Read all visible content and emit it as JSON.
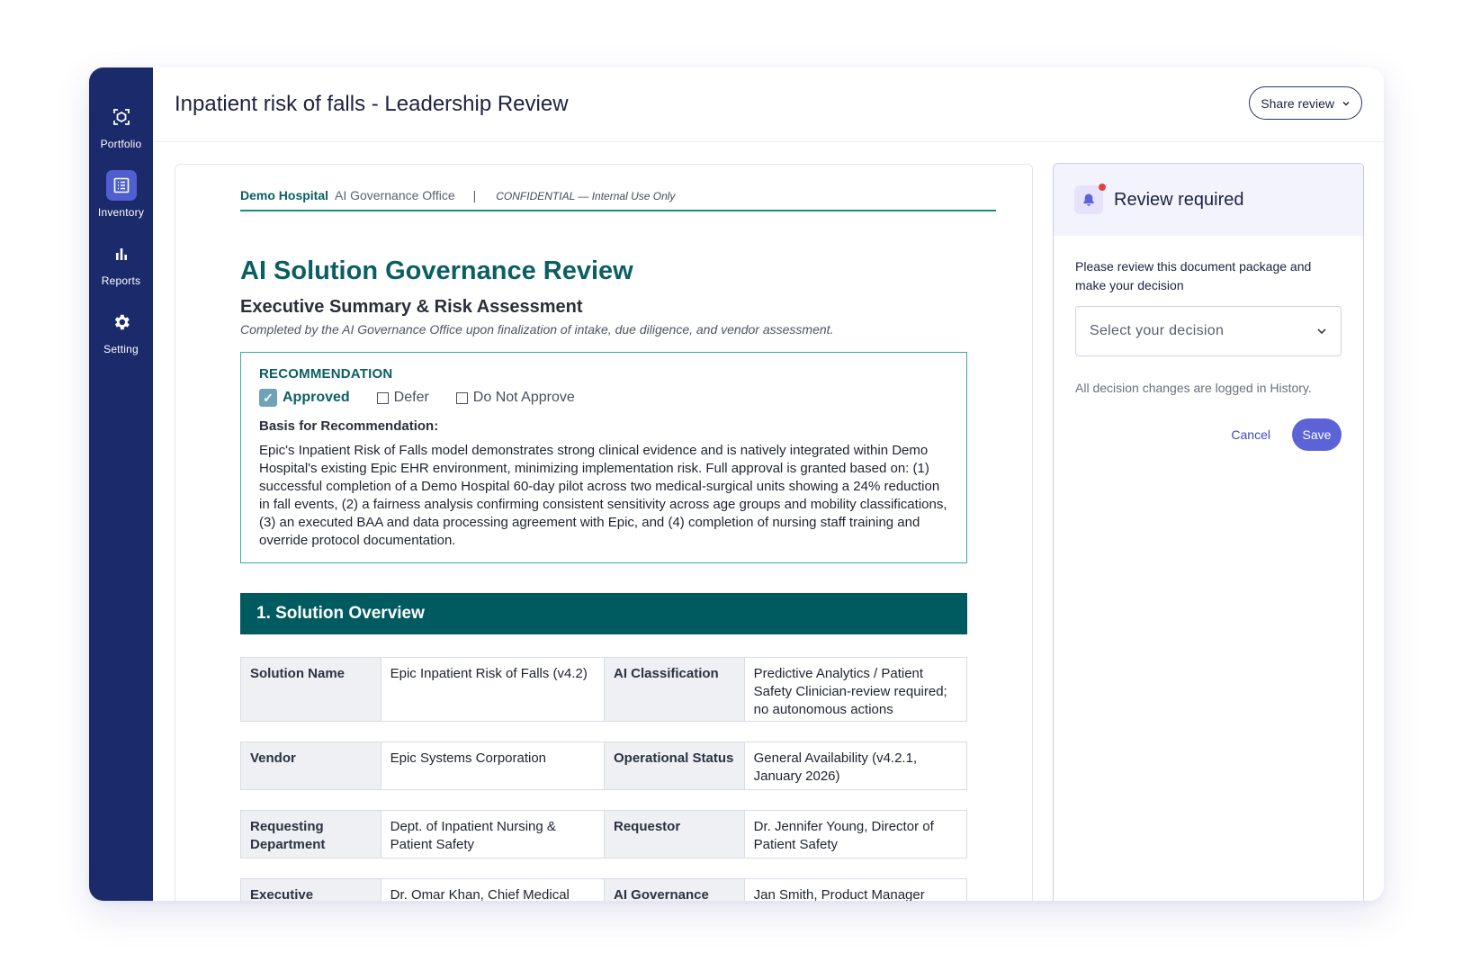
{
  "sidebar": {
    "items": [
      {
        "label": "Portfolio",
        "icon": "portfolio-icon"
      },
      {
        "label": "Inventory",
        "icon": "inventory-icon",
        "active": true
      },
      {
        "label": "Reports",
        "icon": "bar-chart-icon"
      },
      {
        "label": "Setting",
        "icon": "gear-icon"
      }
    ]
  },
  "header": {
    "title": "Inpatient risk of falls - Leadership Review",
    "share_label": "Share review"
  },
  "document": {
    "letterhead": {
      "hospital": "Demo Hospital",
      "office": "AI Governance Office",
      "separator": "|",
      "confidential": "CONFIDENTIAL — Internal Use Only"
    },
    "title": "AI Solution Governance Review",
    "subtitle": "Executive Summary & Risk Assessment",
    "note": "Completed by the AI Governance Office upon finalization of intake, due diligence, and vendor assessment.",
    "recommendation": {
      "title": "RECOMMENDATION",
      "options": [
        {
          "label": "Approved",
          "checked": true
        },
        {
          "label": "Defer",
          "checked": false
        },
        {
          "label": "Do Not Approve",
          "checked": false
        }
      ],
      "basis_label": "Basis for Recommendation:",
      "basis_text": "Epic's Inpatient Risk of Falls model demonstrates strong clinical evidence and is natively integrated within Demo Hospital's existing Epic EHR environment, minimizing implementation risk. Full approval is granted based on: (1) successful completion of a Demo Hospital 60-day pilot across two medical-surgical units showing a 24% reduction in fall events, (2) a fairness analysis confirming consistent sensitivity across age groups and mobility classifications, (3) an executed BAA and data processing agreement with Epic, and (4) completion of nursing staff training and override protocol documentation."
    },
    "section1_title": "1.  Solution Overview",
    "overview": [
      {
        "label1": "Solution Name",
        "value1": "Epic Inpatient Risk of Falls (v4.2)",
        "label2": "AI Classification",
        "value2": "Predictive Analytics / Patient Safety Clinician-review required; no autonomous actions"
      },
      {
        "label1": "Vendor",
        "value1": "Epic Systems Corporation",
        "label2": "Operational Status",
        "value2": "General Availability (v4.2.1, January 2026)"
      },
      {
        "label1": "Requesting Department",
        "value1": "Dept. of Inpatient Nursing & Patient Safety",
        "label2": "Requestor",
        "value2": "Dr. Jennifer Young, Director of Patient Safety"
      },
      {
        "label1": "Executive Sponsor",
        "value1": "Dr. Omar Khan, Chief Medical",
        "label2": "AI Governance",
        "value2": "Jan Smith, Product Manager"
      }
    ]
  },
  "review_panel": {
    "title": "Review required",
    "instructions": "Please review this document package and make your decision",
    "select_placeholder": "Select your decision",
    "log_note": "All decision changes are logged in History.",
    "cancel_label": "Cancel",
    "save_label": "Save"
  },
  "colors": {
    "sidebar": "#1b2a6b",
    "teal": "#0b5f63",
    "section_bar": "#005b60",
    "accent": "#5b63d6",
    "notification": "#e0443c"
  }
}
